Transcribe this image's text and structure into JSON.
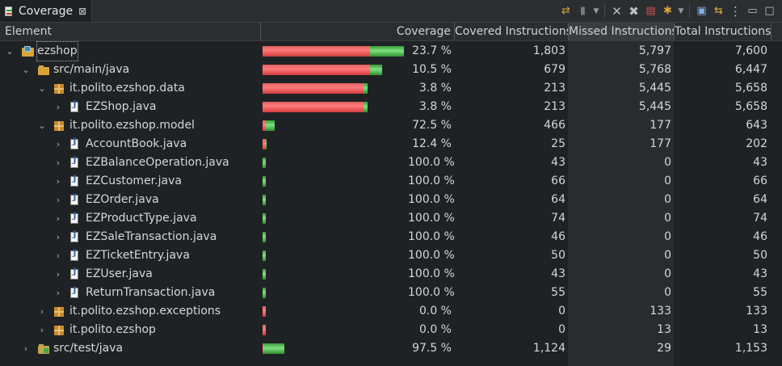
{
  "view": {
    "tab_title": "Coverage",
    "tab_close": "⊠",
    "icons": [
      "relaunch-icon",
      "dump-icon",
      "dropdown-icon",
      "remove-icon",
      "remove-all-icon",
      "merge-icon",
      "pick-session-icon",
      "dropdown-icon",
      "collapse-all-icon",
      "link-icon",
      "view-menu-icon",
      "minimize-icon",
      "maximize-icon"
    ]
  },
  "columns": {
    "element": "Element",
    "coverage": "Coverage",
    "covered": "Covered Instructions",
    "missed": "Missed Instructions",
    "total": "Total Instructions"
  },
  "sort_marker": "⌄",
  "rows": [
    {
      "label": "ezshop",
      "icon": "project-icon",
      "toggle": "⌄",
      "coverage": "23.7 %",
      "covered": "1,803",
      "missed": "5,797",
      "total": "7,600",
      "covered_n": 1803,
      "missed_n": 5797
    },
    {
      "label": "src/main/java",
      "icon": "source-folder-icon",
      "toggle": "⌄",
      "coverage": "10.5 %",
      "covered": "679",
      "missed": "5,768",
      "total": "6,447",
      "covered_n": 679,
      "missed_n": 5768
    },
    {
      "label": "it.polito.ezshop.data",
      "icon": "package-icon",
      "toggle": "⌄",
      "coverage": "3.8 %",
      "covered": "213",
      "missed": "5,445",
      "total": "5,658",
      "covered_n": 213,
      "missed_n": 5445
    },
    {
      "label": "EZShop.java",
      "icon": "java-file-icon",
      "toggle": "›",
      "coverage": "3.8 %",
      "covered": "213",
      "missed": "5,445",
      "total": "5,658",
      "covered_n": 213,
      "missed_n": 5445
    },
    {
      "label": "it.polito.ezshop.model",
      "icon": "package-icon",
      "toggle": "⌄",
      "coverage": "72.5 %",
      "covered": "466",
      "missed": "177",
      "total": "643",
      "covered_n": 466,
      "missed_n": 177
    },
    {
      "label": "AccountBook.java",
      "icon": "java-file-icon",
      "toggle": "›",
      "coverage": "12.4 %",
      "covered": "25",
      "missed": "177",
      "total": "202",
      "covered_n": 25,
      "missed_n": 177
    },
    {
      "label": "EZBalanceOperation.java",
      "icon": "java-file-icon",
      "toggle": "›",
      "coverage": "100.0 %",
      "covered": "43",
      "missed": "0",
      "total": "43",
      "covered_n": 43,
      "missed_n": 0
    },
    {
      "label": "EZCustomer.java",
      "icon": "java-file-icon",
      "toggle": "›",
      "coverage": "100.0 %",
      "covered": "66",
      "missed": "0",
      "total": "66",
      "covered_n": 66,
      "missed_n": 0
    },
    {
      "label": "EZOrder.java",
      "icon": "java-file-icon",
      "toggle": "›",
      "coverage": "100.0 %",
      "covered": "64",
      "missed": "0",
      "total": "64",
      "covered_n": 64,
      "missed_n": 0
    },
    {
      "label": "EZProductType.java",
      "icon": "java-file-icon",
      "toggle": "›",
      "coverage": "100.0 %",
      "covered": "74",
      "missed": "0",
      "total": "74",
      "covered_n": 74,
      "missed_n": 0
    },
    {
      "label": "EZSaleTransaction.java",
      "icon": "java-file-icon",
      "toggle": "›",
      "coverage": "100.0 %",
      "covered": "46",
      "missed": "0",
      "total": "46",
      "covered_n": 46,
      "missed_n": 0
    },
    {
      "label": "EZTicketEntry.java",
      "icon": "java-file-icon",
      "toggle": "›",
      "coverage": "100.0 %",
      "covered": "50",
      "missed": "0",
      "total": "50",
      "covered_n": 50,
      "missed_n": 0
    },
    {
      "label": "EZUser.java",
      "icon": "java-file-icon",
      "toggle": "›",
      "coverage": "100.0 %",
      "covered": "43",
      "missed": "0",
      "total": "43",
      "covered_n": 43,
      "missed_n": 0
    },
    {
      "label": "ReturnTransaction.java",
      "icon": "java-file-icon",
      "toggle": "›",
      "coverage": "100.0 %",
      "covered": "55",
      "missed": "0",
      "total": "55",
      "covered_n": 55,
      "missed_n": 0
    },
    {
      "label": "it.polito.ezshop.exceptions",
      "icon": "package-icon",
      "toggle": "›",
      "coverage": "0.0 %",
      "covered": "0",
      "missed": "133",
      "total": "133",
      "covered_n": 0,
      "missed_n": 133
    },
    {
      "label": "it.polito.ezshop",
      "icon": "package-icon",
      "toggle": "›",
      "coverage": "0.0 %",
      "covered": "0",
      "missed": "13",
      "total": "13",
      "covered_n": 0,
      "missed_n": 13
    },
    {
      "label": "src/test/java",
      "icon": "test-source-folder-icon",
      "toggle": "›",
      "coverage": "97.5 %",
      "covered": "1,124",
      "missed": "29",
      "total": "1,153",
      "covered_n": 1124,
      "missed_n": 29
    }
  ],
  "colors": {
    "covered": "#3fbf3f",
    "missed": "#ff6060",
    "background": "#1f2224"
  }
}
